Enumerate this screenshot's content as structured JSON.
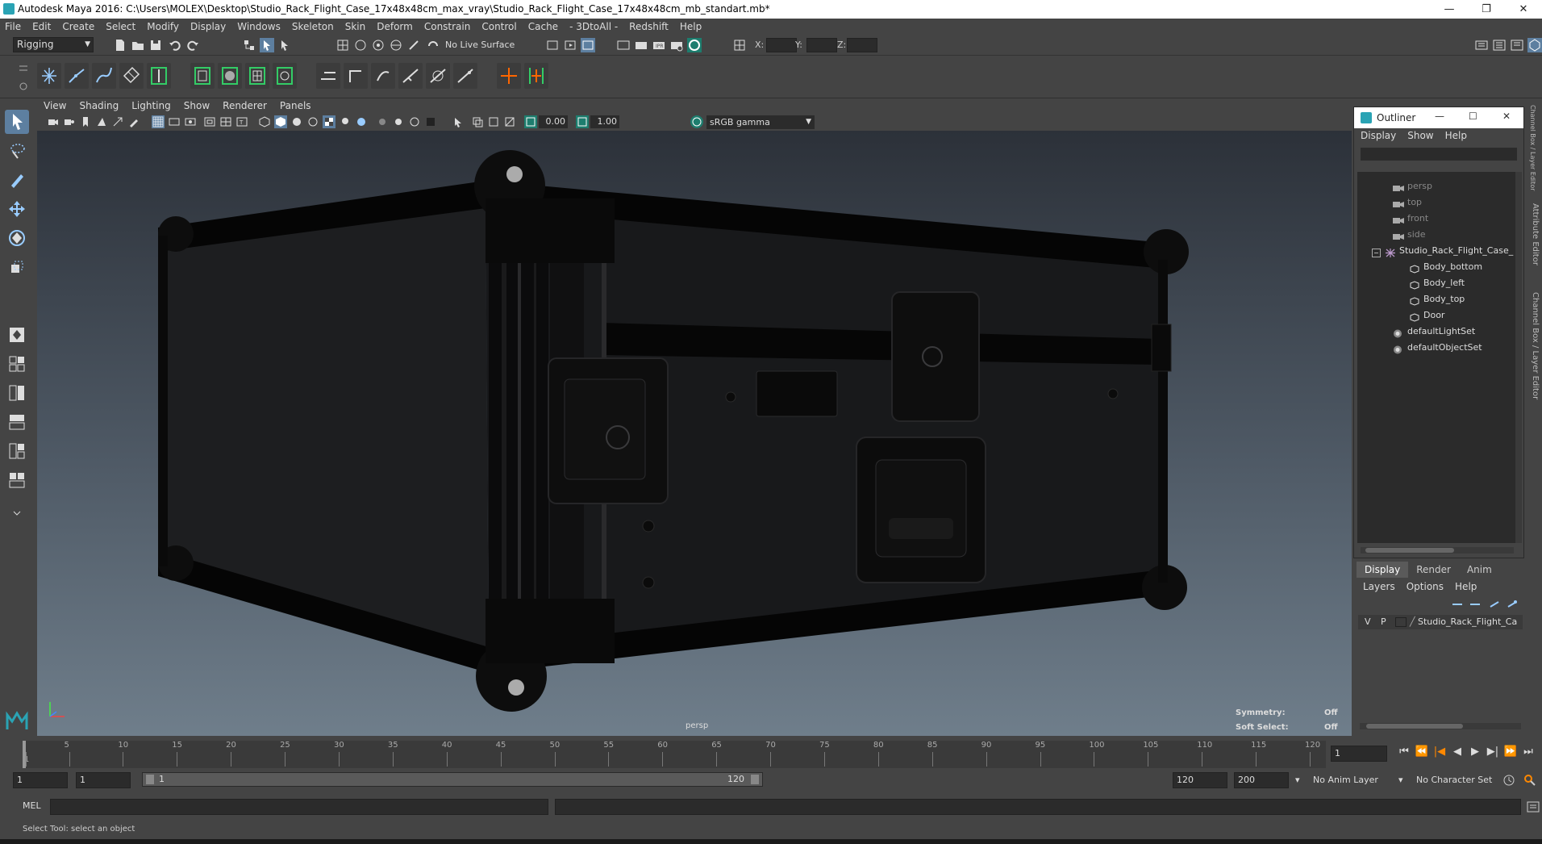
{
  "window": {
    "title": "Autodesk Maya 2016: C:\\Users\\MOLEX\\Desktop\\Studio_Rack_Flight_Case_17x48x48cm_max_vray\\Studio_Rack_Flight_Case_17x48x48cm_mb_standart.mb*",
    "minimize": "—",
    "restore": "❐",
    "close": "✕"
  },
  "menubar": [
    "File",
    "Edit",
    "Create",
    "Select",
    "Modify",
    "Display",
    "Windows",
    "Skeleton",
    "Skin",
    "Deform",
    "Constrain",
    "Control",
    "Cache",
    "- 3DtoAll -",
    "Redshift",
    "Help"
  ],
  "statusline": {
    "mode": "Rigging",
    "live_surface": "No Live Surface",
    "x_label": "X:",
    "y_label": "Y:",
    "z_label": "Z:"
  },
  "panel": {
    "menu": [
      "View",
      "Shading",
      "Lighting",
      "Show",
      "Renderer",
      "Panels"
    ],
    "exposure": "0.00",
    "gamma": "1.00",
    "color_space": "sRGB gamma"
  },
  "viewport": {
    "camera": "persp",
    "symmetry_label": "Symmetry:",
    "symmetry_value": "Off",
    "soft_select_label": "Soft Select:",
    "soft_select_value": "Off"
  },
  "right_tabs": {
    "channel_box": "Channel Box / Layer Editor",
    "attribute_editor": "Attribute Editor",
    "channel_box_side": "Channel Box / Layer Editor"
  },
  "outliner": {
    "title": "Outliner",
    "menu": [
      "Display",
      "Show",
      "Help"
    ],
    "items": [
      {
        "label": "persp"
      },
      {
        "label": "top"
      },
      {
        "label": "front"
      },
      {
        "label": "side"
      },
      {
        "label": "Studio_Rack_Flight_Case_"
      },
      {
        "label": "Body_bottom"
      },
      {
        "label": "Body_left"
      },
      {
        "label": "Body_top"
      },
      {
        "label": "Door"
      },
      {
        "label": "defaultLightSet"
      },
      {
        "label": "defaultObjectSet"
      }
    ]
  },
  "layers": {
    "tabs": [
      "Display",
      "Render",
      "Anim"
    ],
    "menu": [
      "Layers",
      "Options",
      "Help"
    ],
    "row": {
      "v": "V",
      "p": "P",
      "name": "Studio_Rack_Flight_Ca"
    }
  },
  "timeline": {
    "ticks": [
      "1",
      "5",
      "10",
      "15",
      "20",
      "25",
      "30",
      "35",
      "40",
      "45",
      "50",
      "55",
      "60",
      "65",
      "70",
      "75",
      "80",
      "85",
      "90",
      "95",
      "100",
      "105",
      "110",
      "115",
      "120"
    ],
    "current_frame": "1",
    "play_buttons": [
      "⏮",
      "⏪",
      "|◀",
      "◀",
      "▶",
      "▶|",
      "⏩",
      "⏭"
    ]
  },
  "range": {
    "start": "1",
    "playback_start": "1",
    "slider_start": "1",
    "slider_end": "120",
    "playback_end": "120",
    "end": "200",
    "anim_layer": "No Anim Layer",
    "character_set": "No Character Set"
  },
  "mel": {
    "label": "MEL"
  },
  "help": {
    "text": "Select Tool: select an object"
  }
}
